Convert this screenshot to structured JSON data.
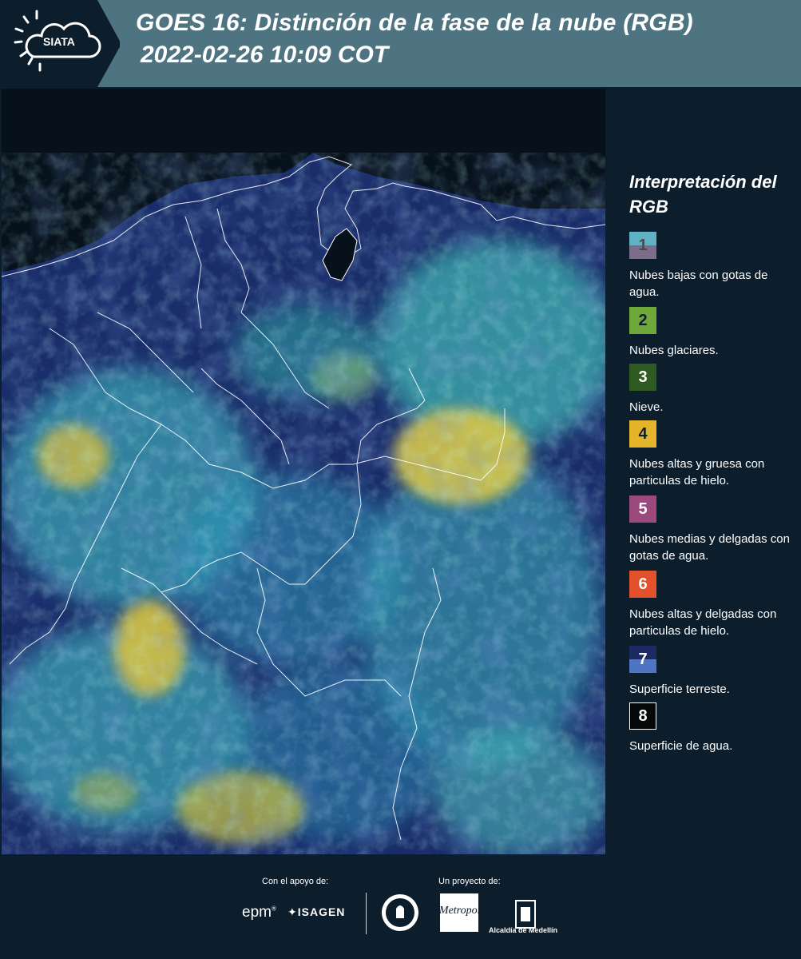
{
  "header": {
    "logo_text": "SIATA",
    "title_line1": "GOES 16: Distinción de la fase de la nube (RGB)",
    "title_line2": "2022-02-26 10:09 COT"
  },
  "legend": {
    "title": "Interpretación del RGB",
    "items": [
      {
        "number": "1",
        "label": "Nubes bajas con gotas de agua.",
        "color_top": "#5fb2c3",
        "color_bottom": "#7c6e8a"
      },
      {
        "number": "2",
        "label": "Nubes glaciares.",
        "color": "#6fa73a"
      },
      {
        "number": "3",
        "label": "Nieve.",
        "color": "#2f5a22"
      },
      {
        "number": "4",
        "label": "Nubes altas y gruesa con particulas de hielo.",
        "color": "#e4b42a"
      },
      {
        "number": "5",
        "label": "Nubes medias y delgadas con gotas de agua.",
        "color": "#9c4a7e"
      },
      {
        "number": "6",
        "label": "Nubes altas y delgadas con particulas de hielo.",
        "color": "#e2512b"
      },
      {
        "number": "7",
        "label": "Superficie terreste.",
        "color_top": "#1b2a63",
        "color_bottom": "#4f74c4"
      },
      {
        "number": "8",
        "label": "Superficie de agua.",
        "color": "#050808"
      }
    ]
  },
  "footer": {
    "support_label": "Con el apoyo de:",
    "project_label": "Un proyecto de:",
    "sponsors": [
      "epm",
      "ISAGEN"
    ],
    "partners": [
      "Área Metropolitana",
      "Alcaldía de Medellín"
    ],
    "medellin_text": "Alcaldía de Medellín"
  },
  "map": {
    "content": "satellite RGB cloud phase imagery over Colombia and Venezuela",
    "colors": {
      "ocean": "#0a141d",
      "land": "#1c2f6b",
      "low_cloud": "#4fb9c6",
      "glaciated": "#7fbf6a",
      "thick_ice": "#d9c24a",
      "borders": "#ffffff"
    }
  }
}
